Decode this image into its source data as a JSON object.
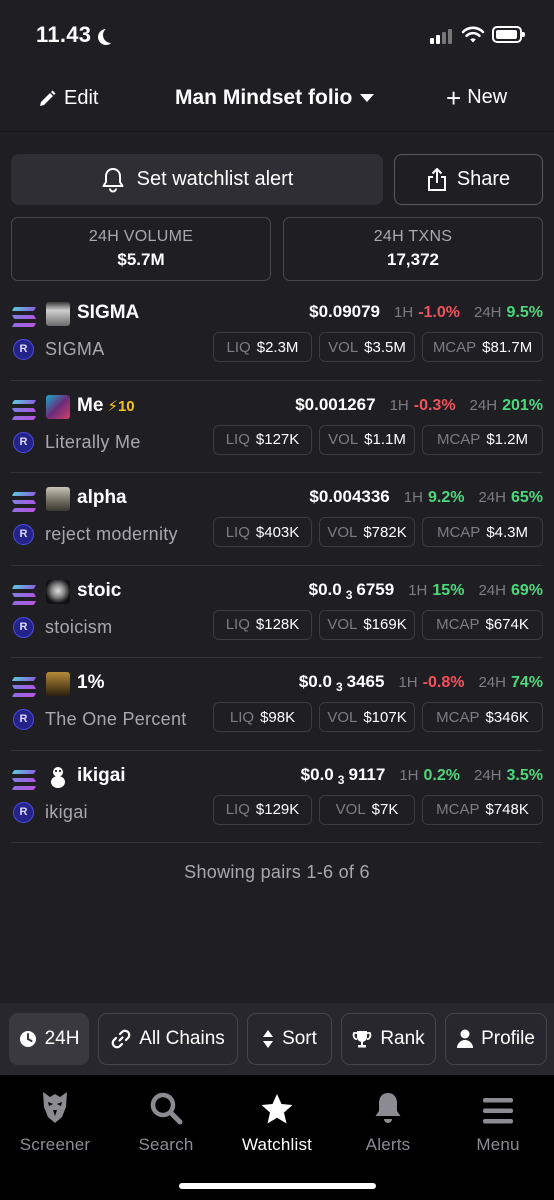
{
  "status_bar": {
    "time": "11.43"
  },
  "header": {
    "edit_label": "Edit",
    "title": "Man Mindset folio",
    "new_label": "New"
  },
  "actions": {
    "alert_label": "Set watchlist alert",
    "share_label": "Share"
  },
  "stats": [
    {
      "label": "24H VOLUME",
      "value": "$5.7M"
    },
    {
      "label": "24H TXNS",
      "value": "17,372"
    }
  ],
  "pairs": [
    {
      "symbol": "SIGMA",
      "boost": "",
      "name": "SIGMA",
      "price_main": "$0.09079",
      "price_sub": "",
      "price_rest": "",
      "h1_label": "1H",
      "h1": "-1.0%",
      "h1_dir": "neg",
      "h24_label": "24H",
      "h24": "9.5%",
      "h24_dir": "pos",
      "liq_label": "LIQ",
      "liq": "$2.3M",
      "vol_label": "VOL",
      "vol": "$3.5M",
      "mcap_label": "MCAP",
      "mcap": "$81.7M"
    },
    {
      "symbol": "Me",
      "boost": "⚡10",
      "name": "Literally Me",
      "price_main": "$0.001267",
      "price_sub": "",
      "price_rest": "",
      "h1_label": "1H",
      "h1": "-0.3%",
      "h1_dir": "neg",
      "h24_label": "24H",
      "h24": "201%",
      "h24_dir": "pos",
      "liq_label": "LIQ",
      "liq": "$127K",
      "vol_label": "VOL",
      "vol": "$1.1M",
      "mcap_label": "MCAP",
      "mcap": "$1.2M"
    },
    {
      "symbol": "alpha",
      "boost": "",
      "name": "reject modernity",
      "price_main": "$0.004336",
      "price_sub": "",
      "price_rest": "",
      "h1_label": "1H",
      "h1": "9.2%",
      "h1_dir": "pos",
      "h24_label": "24H",
      "h24": "65%",
      "h24_dir": "pos",
      "liq_label": "LIQ",
      "liq": "$403K",
      "vol_label": "VOL",
      "vol": "$782K",
      "mcap_label": "MCAP",
      "mcap": "$4.3M"
    },
    {
      "symbol": "stoic",
      "boost": "",
      "name": "stoicism",
      "price_main": "$0.0",
      "price_sub": "3",
      "price_rest": "6759",
      "h1_label": "1H",
      "h1": "15%",
      "h1_dir": "pos",
      "h24_label": "24H",
      "h24": "69%",
      "h24_dir": "pos",
      "liq_label": "LIQ",
      "liq": "$128K",
      "vol_label": "VOL",
      "vol": "$169K",
      "mcap_label": "MCAP",
      "mcap": "$674K"
    },
    {
      "symbol": "1%",
      "boost": "",
      "name": "The One Percent",
      "price_main": "$0.0",
      "price_sub": "3",
      "price_rest": "3465",
      "h1_label": "1H",
      "h1": "-0.8%",
      "h1_dir": "neg",
      "h24_label": "24H",
      "h24": "74%",
      "h24_dir": "pos",
      "liq_label": "LIQ",
      "liq": "$98K",
      "vol_label": "VOL",
      "vol": "$107K",
      "mcap_label": "MCAP",
      "mcap": "$346K"
    },
    {
      "symbol": "ikigai",
      "boost": "",
      "name": "ikigai",
      "price_main": "$0.0",
      "price_sub": "3",
      "price_rest": "9117",
      "h1_label": "1H",
      "h1": "0.2%",
      "h1_dir": "pos",
      "h24_label": "24H",
      "h24": "3.5%",
      "h24_dir": "pos",
      "liq_label": "LIQ",
      "liq": "$129K",
      "vol_label": "VOL",
      "vol": "$7K",
      "mcap_label": "MCAP",
      "mcap": "$748K"
    }
  ],
  "pairs_info": "Showing pairs 1-6 of 6",
  "filters": {
    "timeframe": "24H",
    "chains": "All Chains",
    "sort": "Sort",
    "rank": "Rank",
    "profile": "Profile"
  },
  "tabs": [
    {
      "label": "Screener",
      "icon": "eagle-icon"
    },
    {
      "label": "Search",
      "icon": "search-icon"
    },
    {
      "label": "Watchlist",
      "icon": "star-icon"
    },
    {
      "label": "Alerts",
      "icon": "bell-icon"
    },
    {
      "label": "Menu",
      "icon": "menu-icon"
    }
  ],
  "colors": {
    "positive": "#4cd97b",
    "negative": "#f4515a",
    "boost": "#f4c21b",
    "background": "#1f1e23"
  }
}
